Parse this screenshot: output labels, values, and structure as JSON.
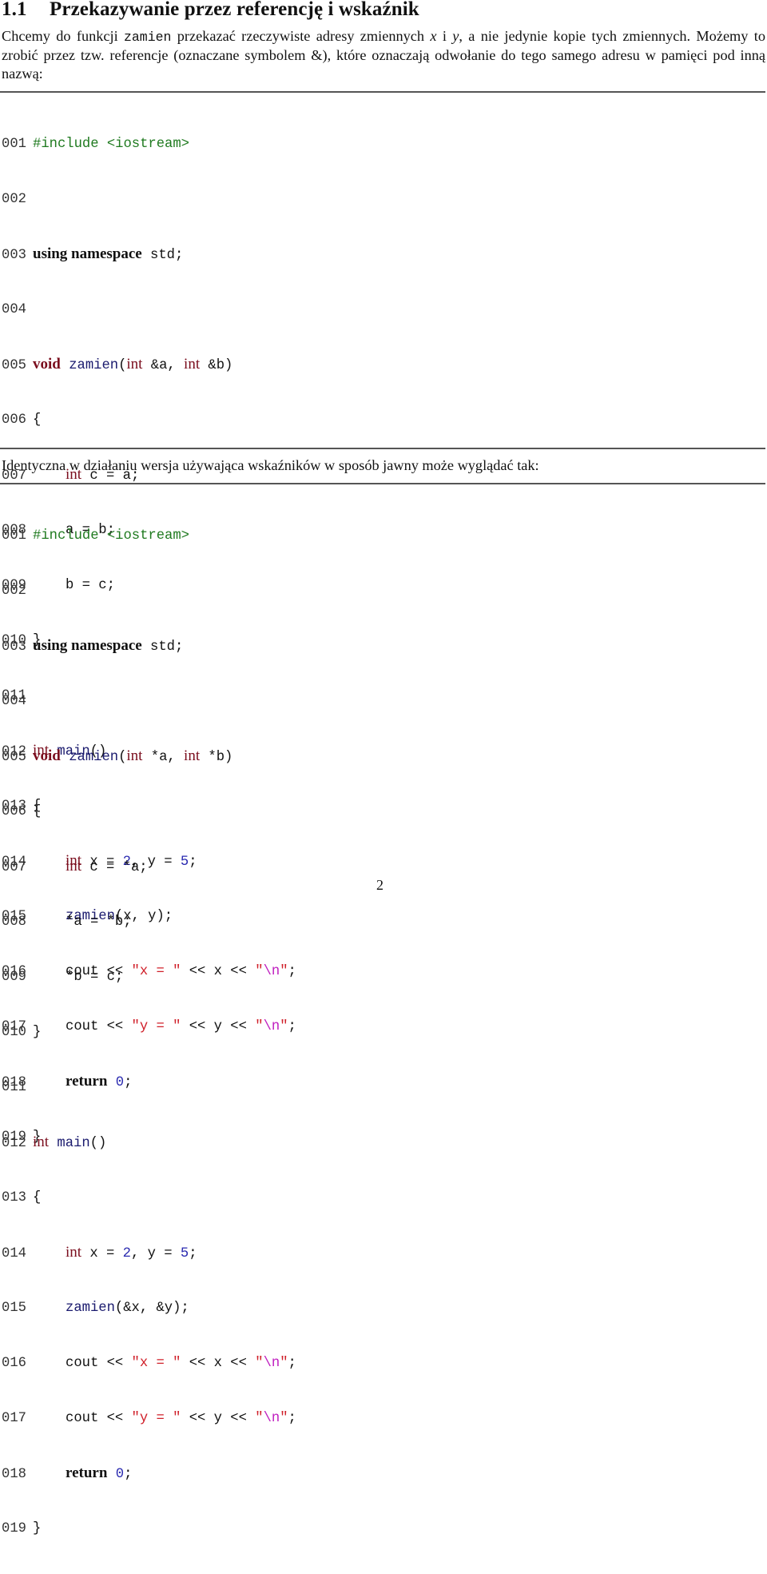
{
  "section": {
    "number": "1.1",
    "title": "Przekazywanie przez referencję i wskaźnik"
  },
  "intro": {
    "part1": "Chcemy do funkcji ",
    "code": "zamien",
    "part2": " przekazać rzeczywiste adresy zmiennych ",
    "var_x": "x",
    "part3": " i ",
    "var_y": "y",
    "part4": ", a nie jedynie kopie tych zmiennych. Możemy to zrobić przez tzw.  referencje (oznaczane symbolem &), które oznaczają odwołanie do tego samego adresu w pamięci pod inną nazwą:"
  },
  "between_text": "Identyczna w działaniu wersja używająca wskaźników w sposób jawny może wyglądać tak:",
  "listing1": {
    "line_numbers": [
      "001",
      "002",
      "003",
      "004",
      "005",
      "006",
      "007",
      "008",
      "009",
      "010",
      "011",
      "012",
      "013",
      "014",
      "015",
      "016",
      "017",
      "018",
      "019"
    ],
    "include": "#include <iostream>",
    "using": "using namespace",
    "std": " std;",
    "void": "void",
    "fname": "zamien",
    "params_open": "(",
    "int": "int",
    "param_a": " &a, ",
    "param_b": " &b)",
    "brace_open": "{",
    "brace_close": "}",
    "l7_rest": " c = a;",
    "l8": "a = b;",
    "l9": "b = c;",
    "main": "main",
    "main_parens": "()",
    "l14_a": " x = ",
    "l14_2": "2",
    "l14_b": ", y = ",
    "l14_5": "5",
    "l14_c": ";",
    "l15_args": "(x, y);",
    "cout": "cout << ",
    "str_x": "\"x = \"",
    "str_y": "\"y = \"",
    "mid_x": " << x << ",
    "mid_y": " << y << ",
    "q": "\"",
    "esc_n": "\\n",
    "end": ";",
    "return": "return",
    "zero": "0",
    "semi": ";"
  },
  "listing2": {
    "param_a": " *a, ",
    "param_b": " *b)",
    "l7_rest": " c = *a;",
    "l8": "*a = *b;",
    "l9": "*b = c;",
    "l15_args": "(&x, &y);"
  },
  "page_number": "2"
}
